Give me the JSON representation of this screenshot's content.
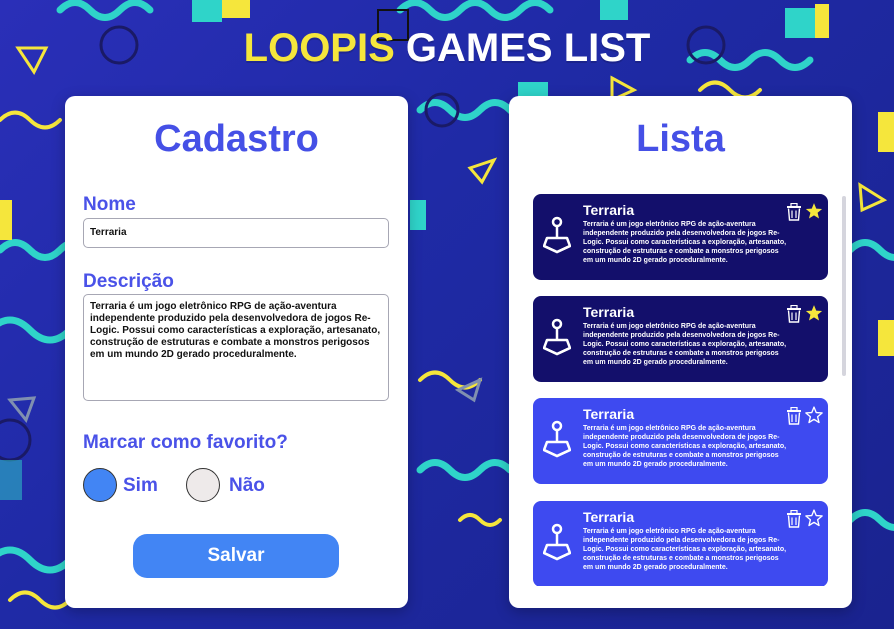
{
  "app": {
    "title_part1": "LOOPIS",
    "title_part2": " GAMES LIST"
  },
  "form": {
    "title": "Cadastro",
    "name_label": "Nome",
    "name_value": "Terraria",
    "desc_label": "Descrição",
    "desc_value": "Terraria é um jogo eletrônico RPG de ação-aventura independente produzido pela desenvolvedora de jogos Re-Logic. Possui como características a exploração, artesanato, construção de estruturas e combate a monstros perigosos em um mundo 2D gerado proceduralmente.",
    "favorite_label": "Marcar como favorito?",
    "option_yes": "Sim",
    "option_no": "Não",
    "selected_option": "Sim",
    "save_label": "Salvar"
  },
  "list": {
    "title": "Lista",
    "cards": [
      {
        "title": "Terraria",
        "description": "Terraria é um jogo eletrônico RPG de ação-aventura independente produzido pela desenvolvedora de jogos Re-Logic. Possui como características a exploração, artesanato, construção de estruturas e combate a monstros perigosos em um mundo 2D gerado proceduralmente.",
        "favorite": true
      },
      {
        "title": "Terraria",
        "description": "Terraria é um jogo eletrônico RPG de ação-aventura independente produzido pela desenvolvedora de jogos Re-Logic. Possui como características a exploração, artesanato, construção de estruturas e combate a monstros perigosos em um mundo 2D gerado proceduralmente.",
        "favorite": true
      },
      {
        "title": "Terraria",
        "description": "Terraria é um jogo eletrônico RPG de ação-aventura independente produzido pela desenvolvedora de jogos Re-Logic. Possui como características a exploração, artesanato, construção de estruturas e combate a monstros perigosos em um mundo 2D gerado proceduralmente.",
        "favorite": false
      },
      {
        "title": "Terraria",
        "description": "Terraria é um jogo eletrônico RPG de ação-aventura independente produzido pela desenvolvedora de jogos Re-Logic. Possui como características a exploração, artesanato, construção de estruturas e combate a monstros perigosos em um mundo 2D gerado proceduralmente.",
        "favorite": false
      }
    ]
  },
  "icons": {
    "game": "joystick-icon",
    "delete": "trash-icon",
    "favorite_on": "star-filled-icon",
    "favorite_off": "star-outline-icon"
  },
  "colors": {
    "accent_blue": "#4285f4",
    "heading_blue": "#4550e6",
    "card_favorite": "#130f6b",
    "card_regular": "#3e4af0",
    "title_yellow": "#f5e63c",
    "star_yellow": "#f5e63c"
  }
}
